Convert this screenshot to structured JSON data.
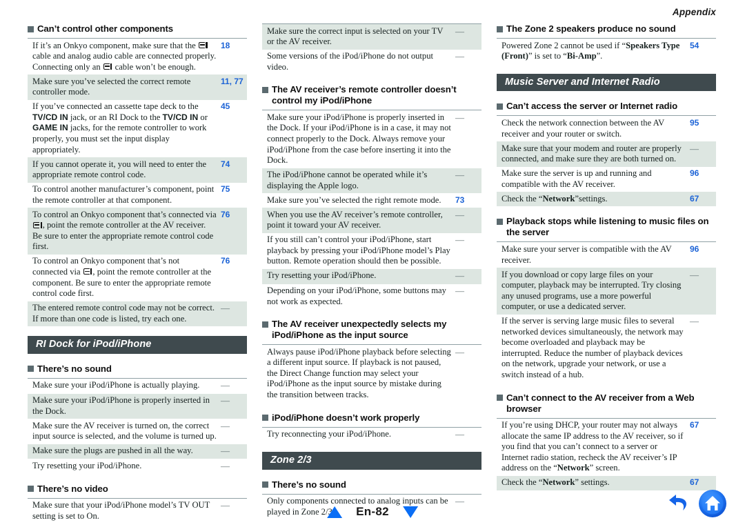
{
  "page": {
    "running_head": "Appendix",
    "page_label": "En-82"
  },
  "footer": {
    "prev_icon": "triangle-up-icon",
    "next_icon": "triangle-down-icon",
    "back_icon": "undo-arrow-icon",
    "home_icon": "home-icon"
  },
  "columns": [
    {
      "blocks": [
        {
          "type": "subheading",
          "title": "Can’t control other components"
        },
        {
          "type": "table",
          "rows": [
            {
              "page": "18",
              "shaded": false,
              "parts": [
                {
                  "t": "If it’s an Onkyo component, make sure that the "
                },
                {
                  "t": "RI",
                  "style": "ri"
                },
                {
                  "t": " cable and analog audio cable are connected properly. Connecting only an "
                },
                {
                  "t": "RI",
                  "style": "ri"
                },
                {
                  "t": " cable won’t be enough."
                }
              ]
            },
            {
              "page": "11, 77",
              "shaded": true,
              "parts": [
                {
                  "t": "Make sure you’ve selected the correct remote controller mode."
                }
              ]
            },
            {
              "page": "45",
              "shaded": false,
              "parts": [
                {
                  "t": "If you’ve connected an cassette tape deck to the "
                },
                {
                  "t": "TV/CD IN",
                  "style": "b"
                },
                {
                  "t": " jack, or an RI Dock to the "
                },
                {
                  "t": "TV/CD IN",
                  "style": "b"
                },
                {
                  "t": " or "
                },
                {
                  "t": "GAME IN",
                  "style": "b"
                },
                {
                  "t": " jacks, for the remote controller to work properly, you must set the input display appropriately."
                }
              ]
            },
            {
              "page": "74",
              "shaded": true,
              "parts": [
                {
                  "t": "If you cannot operate it, you will need to enter the appropriate remote control code."
                }
              ]
            },
            {
              "page": "75",
              "shaded": false,
              "parts": [
                {
                  "t": "To control another manufacturer’s component, point the remote controller at that component."
                }
              ]
            },
            {
              "page": "76",
              "shaded": true,
              "parts": [
                {
                  "t": "To control an Onkyo component that’s connected via "
                },
                {
                  "t": "RI",
                  "style": "ri"
                },
                {
                  "t": ", point the remote controller at the AV receiver. Be sure to enter the appropriate remote control code first."
                }
              ]
            },
            {
              "page": "76",
              "shaded": false,
              "parts": [
                {
                  "t": "To control an Onkyo component that’s not connected via "
                },
                {
                  "t": "RI",
                  "style": "ri"
                },
                {
                  "t": ", point the remote controller at the component. Be sure to enter the appropriate remote control code first."
                }
              ]
            },
            {
              "page": "—",
              "shaded": true,
              "parts": [
                {
                  "t": "The entered remote control code may not be correct. If more than one code is listed, try each one."
                }
              ]
            }
          ]
        },
        {
          "type": "band",
          "title": "RI Dock for iPod/iPhone"
        },
        {
          "type": "subheading",
          "title": "There’s no sound"
        },
        {
          "type": "table",
          "rows": [
            {
              "page": "—",
              "shaded": false,
              "parts": [
                {
                  "t": "Make sure your iPod/iPhone is actually playing."
                }
              ]
            },
            {
              "page": "—",
              "shaded": true,
              "parts": [
                {
                  "t": "Make sure your iPod/iPhone is properly inserted in the Dock."
                }
              ]
            },
            {
              "page": "—",
              "shaded": false,
              "parts": [
                {
                  "t": "Make sure the AV receiver is turned on, the correct input source is selected, and the volume is turned up."
                }
              ]
            },
            {
              "page": "—",
              "shaded": true,
              "parts": [
                {
                  "t": "Make sure the plugs are pushed in all the way."
                }
              ]
            },
            {
              "page": "—",
              "shaded": false,
              "parts": [
                {
                  "t": "Try resetting your iPod/iPhone."
                }
              ]
            }
          ]
        },
        {
          "type": "subheading",
          "title": "There’s no video"
        },
        {
          "type": "table",
          "rows": [
            {
              "page": "—",
              "shaded": false,
              "parts": [
                {
                  "t": "Make sure that your iPod/iPhone model’s TV OUT setting is set to On."
                }
              ]
            }
          ]
        }
      ]
    },
    {
      "blocks": [
        {
          "type": "table",
          "rows": [
            {
              "page": "—",
              "shaded": true,
              "parts": [
                {
                  "t": "Make sure the correct input is selected on your TV or the AV receiver."
                }
              ]
            },
            {
              "page": "—",
              "shaded": false,
              "parts": [
                {
                  "t": "Some versions of the iPod/iPhone do not output video."
                }
              ]
            }
          ]
        },
        {
          "type": "subheading",
          "title": "The AV receiver’s remote controller doesn’t control my iPod/iPhone"
        },
        {
          "type": "table",
          "rows": [
            {
              "page": "—",
              "shaded": false,
              "parts": [
                {
                  "t": "Make sure your iPod/iPhone is properly inserted in the Dock. If your iPod/iPhone is in a case, it may not connect properly to the Dock. Always remove your iPod/iPhone from the case before inserting it into the Dock."
                }
              ]
            },
            {
              "page": "—",
              "shaded": true,
              "parts": [
                {
                  "t": "The iPod/iPhone cannot be operated while it’s displaying the Apple logo."
                }
              ]
            },
            {
              "page": "73",
              "shaded": false,
              "parts": [
                {
                  "t": "Make sure you’ve selected the right remote mode."
                }
              ]
            },
            {
              "page": "—",
              "shaded": true,
              "parts": [
                {
                  "t": "When you use the AV receiver’s remote controller, point it toward your AV receiver."
                }
              ]
            },
            {
              "page": "—",
              "shaded": false,
              "parts": [
                {
                  "t": "If you still can’t control your iPod/iPhone, start playback by pressing your iPod/iPhone model’s Play button. Remote operation should then be possible."
                }
              ]
            },
            {
              "page": "—",
              "shaded": true,
              "parts": [
                {
                  "t": "Try resetting your iPod/iPhone."
                }
              ]
            },
            {
              "page": "—",
              "shaded": false,
              "parts": [
                {
                  "t": "Depending on your iPod/iPhone, some buttons may not work as expected."
                }
              ]
            }
          ]
        },
        {
          "type": "subheading",
          "title": "The AV receiver unexpectedly selects my iPod/iPhone as the input source"
        },
        {
          "type": "table",
          "rows": [
            {
              "page": "—",
              "shaded": false,
              "parts": [
                {
                  "t": "Always pause iPod/iPhone playback before selecting a different input source. If playback is not paused, the Direct Change function may select your iPod/iPhone as the input source by mistake during the transition between tracks."
                }
              ]
            }
          ]
        },
        {
          "type": "subheading",
          "title": "iPod/iPhone doesn’t work properly"
        },
        {
          "type": "table",
          "rows": [
            {
              "page": "—",
              "shaded": false,
              "parts": [
                {
                  "t": "Try reconnecting your iPod/iPhone."
                }
              ]
            }
          ]
        },
        {
          "type": "band",
          "title": "Zone 2/3"
        },
        {
          "type": "subheading",
          "title": "There’s no sound"
        },
        {
          "type": "table",
          "rows": [
            {
              "page": "—",
              "shaded": false,
              "parts": [
                {
                  "t": "Only components connected to analog inputs can be played in Zone 2/3."
                }
              ]
            }
          ]
        }
      ]
    },
    {
      "blocks": [
        {
          "type": "subheading",
          "title": "The Zone 2 speakers produce no sound"
        },
        {
          "type": "table",
          "rows": [
            {
              "page": "54",
              "shaded": false,
              "parts": [
                {
                  "t": "Powered Zone 2 cannot be used if “"
                },
                {
                  "t": "Speakers Type (Front)",
                  "style": "bs"
                },
                {
                  "t": "” is set to “"
                },
                {
                  "t": "Bi-Amp",
                  "style": "bs"
                },
                {
                  "t": "”."
                }
              ]
            }
          ]
        },
        {
          "type": "band",
          "title": "Music Server and Internet Radio"
        },
        {
          "type": "subheading",
          "title": "Can’t access the server or Internet radio"
        },
        {
          "type": "table",
          "rows": [
            {
              "page": "95",
              "shaded": false,
              "parts": [
                {
                  "t": "Check the network connection between the AV receiver and your router or switch."
                }
              ]
            },
            {
              "page": "—",
              "shaded": true,
              "parts": [
                {
                  "t": "Make sure that your modem and router are properly connected, and make sure they are both turned on."
                }
              ]
            },
            {
              "page": "96",
              "shaded": false,
              "parts": [
                {
                  "t": "Make sure the server is up and running and compatible with the AV receiver."
                }
              ]
            },
            {
              "page": "67",
              "shaded": true,
              "parts": [
                {
                  "t": "Check the “"
                },
                {
                  "t": "Network",
                  "style": "bs"
                },
                {
                  "t": "”settings."
                }
              ]
            }
          ]
        },
        {
          "type": "subheading",
          "title": "Playback stops while listening to music files on the server"
        },
        {
          "type": "table",
          "rows": [
            {
              "page": "96",
              "shaded": false,
              "parts": [
                {
                  "t": "Make sure your server is compatible with the AV receiver."
                }
              ]
            },
            {
              "page": "—",
              "shaded": true,
              "parts": [
                {
                  "t": "If you download or copy large files on your computer, playback may be interrupted. Try closing any unused programs, use a more powerful computer, or use a dedicated server."
                }
              ]
            },
            {
              "page": "—",
              "shaded": false,
              "parts": [
                {
                  "t": "If the server is serving large music files to several networked devices simultaneously, the network may become overloaded and playback may be interrupted. Reduce the number of playback devices on the network, upgrade your network, or use a switch instead of a hub."
                }
              ]
            }
          ]
        },
        {
          "type": "subheading",
          "title": "Can’t connect to the AV receiver from a Web browser"
        },
        {
          "type": "table",
          "rows": [
            {
              "page": "67",
              "shaded": false,
              "parts": [
                {
                  "t": "If you’re using DHCP, your router may not always allocate the same IP address to the AV receiver, so if you find that you can’t connect to a server or Internet radio station, recheck the AV receiver’s IP address on the “"
                },
                {
                  "t": "Network",
                  "style": "bs"
                },
                {
                  "t": "” screen."
                }
              ]
            },
            {
              "page": "67",
              "shaded": true,
              "parts": [
                {
                  "t": "Check the “"
                },
                {
                  "t": "Network",
                  "style": "bs"
                },
                {
                  "t": "” settings."
                }
              ]
            }
          ]
        }
      ]
    }
  ]
}
